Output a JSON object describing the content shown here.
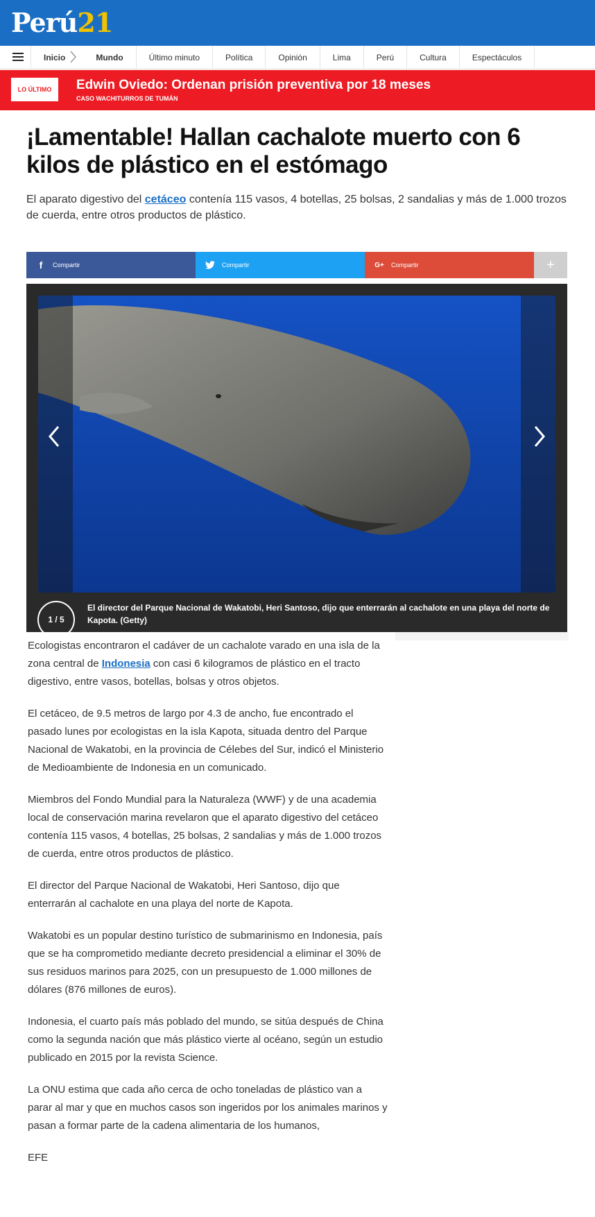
{
  "header": {
    "logo_text": "Perú",
    "logo_num": "21"
  },
  "nav": {
    "items": [
      {
        "label": "Inicio"
      },
      {
        "label": "Mundo"
      },
      {
        "label": "Último minuto"
      },
      {
        "label": "Política"
      },
      {
        "label": "Opinión"
      },
      {
        "label": "Lima"
      },
      {
        "label": "Perú"
      },
      {
        "label": "Cultura"
      },
      {
        "label": "Espectáculos"
      }
    ]
  },
  "breaking": {
    "tag": "LO ÚLTIMO",
    "headline": "Edwin Oviedo: Ordenan prisión preventiva por 18 meses",
    "sub": "CASO WACHITURROS DE TUMÁN"
  },
  "article": {
    "title": "¡Lamentable! Hallan cachalote muerto con 6 kilos de plástico en el estómago",
    "lead_before": "El aparato digestivo del ",
    "lead_link": "cetáceo",
    "lead_after": " contenía 115 vasos, 4 botellas, 25 bolsas, 2 sandalias y más de 1.000 trozos de cuerda, entre otros productos de plástico.",
    "p1_before": "Ecologistas encontraron el cadáver de un cachalote varado en una isla de la zona central de ",
    "p1_link": "Indonesia",
    "p1_after": " con casi 6 kilogramos de plástico en el tracto digestivo, entre vasos, botellas, bolsas y otros objetos.",
    "p2": "El cetáceo, de 9.5 metros de largo por 4.3 de ancho, fue encontrado el pasado lunes por ecologistas en la isla Kapota, situada dentro del Parque Nacional de Wakatobi, en la provincia de Célebes del Sur, indicó el Ministerio de Medioambiente de Indonesia en un comunicado.",
    "p3": "Miembros del Fondo Mundial para la Naturaleza (WWF) y de una academia local de conservación marina revelaron que el aparato digestivo del cetáceo contenía 115 vasos, 4 botellas, 25 bolsas, 2 sandalias y más de 1.000 trozos de cuerda, entre otros productos de plástico.",
    "p4": "El director del Parque Nacional de Wakatobi, Heri Santoso, dijo que enterrarán al cachalote en una playa del norte de Kapota.",
    "p5": "Wakatobi es un popular destino turístico de submarinismo en Indonesia, país que se ha comprometido mediante decreto presidencial a eliminar el 30% de sus residuos marinos para 2025, con un presupuesto de 1.000 millones de dólares (876 millones de euros).",
    "p6": "Indonesia, el cuarto país más poblado del mundo, se sitúa después de China como la segunda nación que más plástico vierte al océano, según un estudio publicado en 2015 por la revista Science.",
    "p7": "La ONU estima que cada año cerca de ocho toneladas de plástico van a parar al mar y que en muchos casos son ingeridos por los animales marinos y pasan a formar parte de la cadena alimentaria de los humanos,",
    "signature": "EFE"
  },
  "share": {
    "facebook": "Compartir",
    "twitter": "Compartir",
    "google": "Compartir",
    "more": "+"
  },
  "gallery": {
    "counter": "1 / 5",
    "caption": "El director del Parque Nacional de Wakatobi, Heri Santoso, dijo que enterrarán al cachalote en una playa del norte de Kapota. (Getty)"
  }
}
